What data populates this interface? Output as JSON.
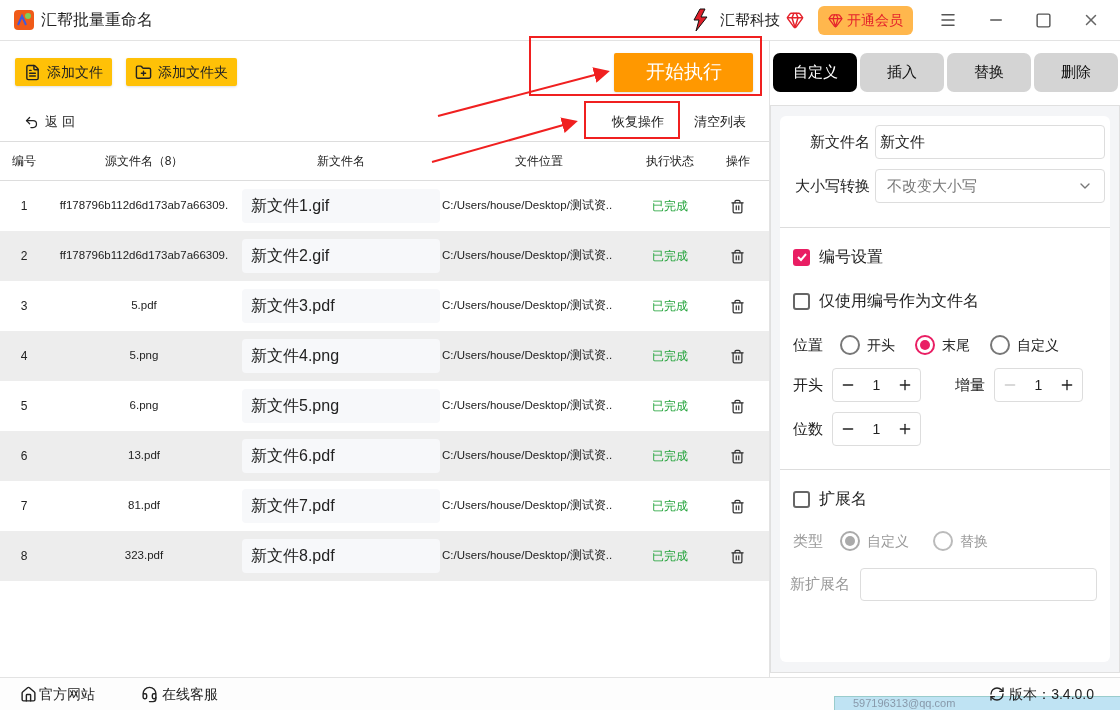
{
  "window": {
    "title": "汇帮批量重命名",
    "brand": "汇帮科技",
    "vip_button": "开通会员"
  },
  "toolbar": {
    "add_file": "添加文件",
    "add_folder": "添加文件夹",
    "start": "开始执行"
  },
  "actions": {
    "back": "返 回",
    "restore": "恢复操作",
    "clear": "清空列表"
  },
  "table": {
    "columns": [
      "编号",
      "源文件名（8）",
      "新文件名",
      "文件位置",
      "执行状态",
      "操作"
    ],
    "rows": [
      {
        "index": "1",
        "source": "ff178796b112d6d173ab7a66309.",
        "new_name": "新文件1.gif",
        "location": "C:/Users/house/Desktop/测试资..",
        "status": "已完成"
      },
      {
        "index": "2",
        "source": "ff178796b112d6d173ab7a66309.",
        "new_name": "新文件2.gif",
        "location": "C:/Users/house/Desktop/测试资..",
        "status": "已完成"
      },
      {
        "index": "3",
        "source": "5.pdf",
        "new_name": "新文件3.pdf",
        "location": "C:/Users/house/Desktop/测试资..",
        "status": "已完成"
      },
      {
        "index": "4",
        "source": "5.png",
        "new_name": "新文件4.png",
        "location": "C:/Users/house/Desktop/测试资..",
        "status": "已完成"
      },
      {
        "index": "5",
        "source": "6.png",
        "new_name": "新文件5.png",
        "location": "C:/Users/house/Desktop/测试资..",
        "status": "已完成"
      },
      {
        "index": "6",
        "source": "13.pdf",
        "new_name": "新文件6.pdf",
        "location": "C:/Users/house/Desktop/测试资..",
        "status": "已完成"
      },
      {
        "index": "7",
        "source": "81.pdf",
        "new_name": "新文件7.pdf",
        "location": "C:/Users/house/Desktop/测试资..",
        "status": "已完成"
      },
      {
        "index": "8",
        "source": "323.pdf",
        "new_name": "新文件8.pdf",
        "location": "C:/Users/house/Desktop/测试资..",
        "status": "已完成"
      }
    ]
  },
  "tabs": [
    {
      "label": "自定义",
      "selected": true
    },
    {
      "label": "插入",
      "selected": false
    },
    {
      "label": "替换",
      "selected": false
    },
    {
      "label": "删除",
      "selected": false
    }
  ],
  "settings": {
    "new_name_label": "新文件名",
    "new_name_value": "新文件",
    "case_label": "大小写转换",
    "case_value": "不改变大小写",
    "numbering": {
      "label": "编号设置",
      "checked": true
    },
    "number_only": {
      "label": "仅使用编号作为文件名",
      "checked": false
    },
    "position_label": "位置",
    "positions": [
      {
        "label": "开头",
        "selected": false
      },
      {
        "label": "末尾",
        "selected": true
      },
      {
        "label": "自定义",
        "selected": false
      }
    ],
    "steppers": [
      {
        "label": "开头",
        "value": "1",
        "minus_disabled": false
      },
      {
        "label": "增量",
        "value": "1",
        "minus_disabled": true
      },
      {
        "label": "位数",
        "value": "1",
        "minus_disabled": false
      }
    ],
    "extension": {
      "label": "扩展名",
      "checked": false
    },
    "type_label": "类型",
    "types": [
      {
        "label": "自定义",
        "selected": true
      },
      {
        "label": "替换",
        "selected": false
      }
    ],
    "new_ext_label": "新扩展名"
  },
  "footer": {
    "website": "官方网站",
    "support": "在线客服",
    "version": "版本：3.4.0.0",
    "popup": "597196313@qq.com"
  }
}
